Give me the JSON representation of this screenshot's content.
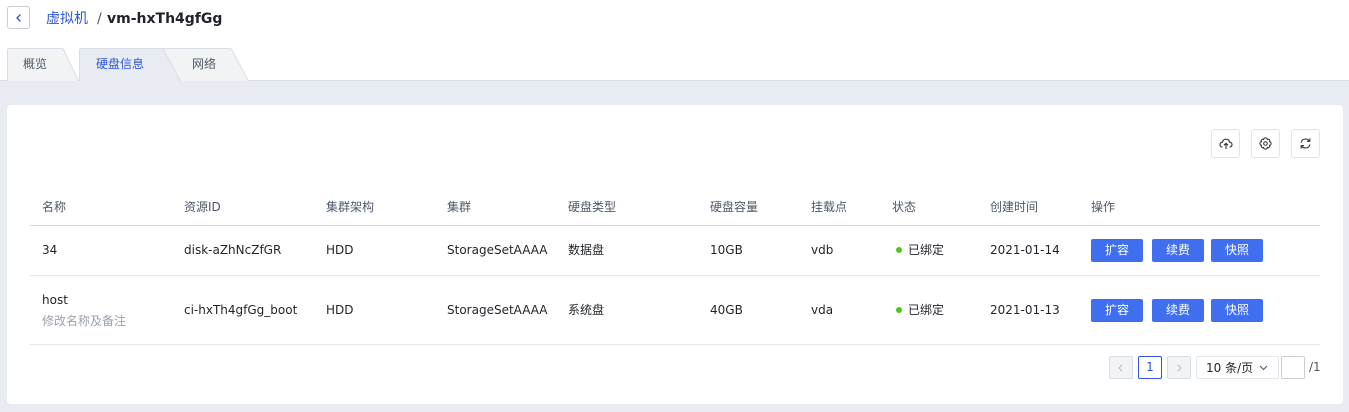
{
  "breadcrumb": {
    "parent": "虚拟机",
    "separator": "/",
    "current": "vm-hxTh4gfGg"
  },
  "tabs": [
    {
      "label": "概览",
      "active": false
    },
    {
      "label": "硬盘信息",
      "active": true
    },
    {
      "label": "网络",
      "active": false
    }
  ],
  "toolbar": {
    "icons": [
      "cloud-upload-icon",
      "gear-icon",
      "refresh-icon"
    ]
  },
  "table": {
    "columns": [
      "名称",
      "资源ID",
      "集群架构",
      "集群",
      "硬盘类型",
      "硬盘容量",
      "挂载点",
      "状态",
      "创建时间",
      "操作"
    ],
    "rows": [
      {
        "name": "34",
        "name_note": "",
        "resource_id": "disk-aZhNcZfGR",
        "arch": "HDD",
        "cluster": "StorageSetAAAA",
        "disk_type": "数据盘",
        "capacity": "10GB",
        "mount": "vdb",
        "status": "已绑定",
        "created": "2021-01-14",
        "actions": [
          "扩容",
          "续费",
          "快照"
        ]
      },
      {
        "name": "host",
        "name_note": "修改名称及备注",
        "resource_id": "ci-hxTh4gfGg_boot",
        "arch": "HDD",
        "cluster": "StorageSetAAAA",
        "disk_type": "系统盘",
        "capacity": "40GB",
        "mount": "vda",
        "status": "已绑定",
        "created": "2021-01-13",
        "actions": [
          "扩容",
          "续费",
          "快照"
        ]
      }
    ]
  },
  "pagination": {
    "current_page": "1",
    "page_size": "10 条/页",
    "jump_value": "",
    "total_pages": "/1"
  },
  "colors": {
    "accent": "#2e55d8",
    "action_button": "#3f6fef",
    "status_ok": "#52c41a",
    "content_bg": "#e8ebf2"
  }
}
